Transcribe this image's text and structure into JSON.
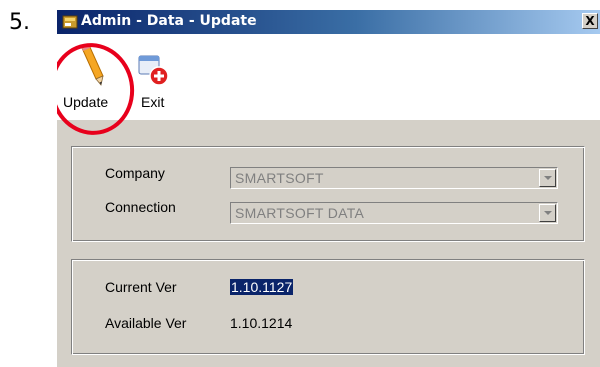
{
  "step": {
    "number": "5."
  },
  "window": {
    "title": "Admin - Data - Update",
    "close_label": "X"
  },
  "toolbar": {
    "update_label": "Update",
    "exit_label": "Exit"
  },
  "connection_group": {
    "company_label": "Company",
    "company_value": "SMARTSOFT",
    "connection_label": "Connection",
    "connection_value": "SMARTSOFT DATA"
  },
  "version_group": {
    "current_label": "Current Ver",
    "current_value": "1.10.1127",
    "available_label": "Available Ver",
    "available_value": "1.10.1214"
  },
  "icons": {
    "title_icon": "app-window-icon",
    "update_icon": "pencil-icon",
    "exit_icon": "exit-icon"
  },
  "colors": {
    "titlebar": "#0a246a",
    "highlight_circle": "#e8001c",
    "selection": "#0a246a"
  }
}
